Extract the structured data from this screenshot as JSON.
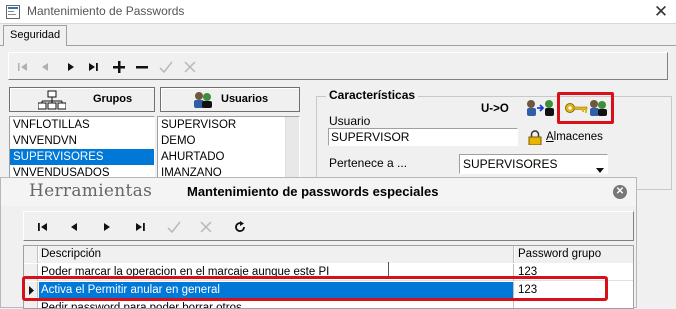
{
  "window": {
    "title": "Mantenimiento de Passwords",
    "app_icon": "app-form-icon",
    "close_glyph": "✕"
  },
  "tabs": [
    {
      "label": "Seguridad",
      "active": true
    }
  ],
  "toolbar": {
    "buttons": [
      "first-record-icon",
      "prior-record-icon",
      "next-record-icon",
      "last-record-icon",
      "add-icon",
      "delete-icon",
      "confirm-icon",
      "cancel-icon"
    ]
  },
  "grupos": {
    "button_label": "Grupos",
    "items": [
      "VNFLOTILLAS",
      "VNVENDVN",
      "SUPERVISORES",
      "VNVENDUSADOS"
    ],
    "selected": "SUPERVISORES"
  },
  "usuarios": {
    "button_label": "Usuarios",
    "items": [
      "SUPERVISOR",
      "DEMO",
      "AHURTADO",
      "IMANZANO"
    ],
    "selected": "SUPERVISOR"
  },
  "caracteristicas": {
    "title": "Características",
    "ux_label": "U->O",
    "usuario_label": "Usuario",
    "usuario_value": "SUPERVISOR",
    "almacenes_label": "Almacenes",
    "pertenece_label": "Pertenece a ...",
    "grupo_value": "SUPERVISORES"
  },
  "modal": {
    "brand": "Herramientas",
    "title": "Mantenimiento de passwords especiales",
    "close_glyph": "✕",
    "grid": {
      "columns": [
        "Descripción",
        "Password grupo"
      ],
      "rows": [
        {
          "descripcion": "Poder marcar la operacion en el marcaje aunque este PI",
          "password": "123"
        },
        {
          "descripcion": "Activa el Permitir anular en general",
          "password": "123"
        },
        {
          "descripcion": "Pedir password para poder borrar otros",
          "password": ""
        }
      ],
      "selected_index": 1
    }
  },
  "colors": {
    "highlight": "#d8101a",
    "selection": "#0078d7"
  }
}
